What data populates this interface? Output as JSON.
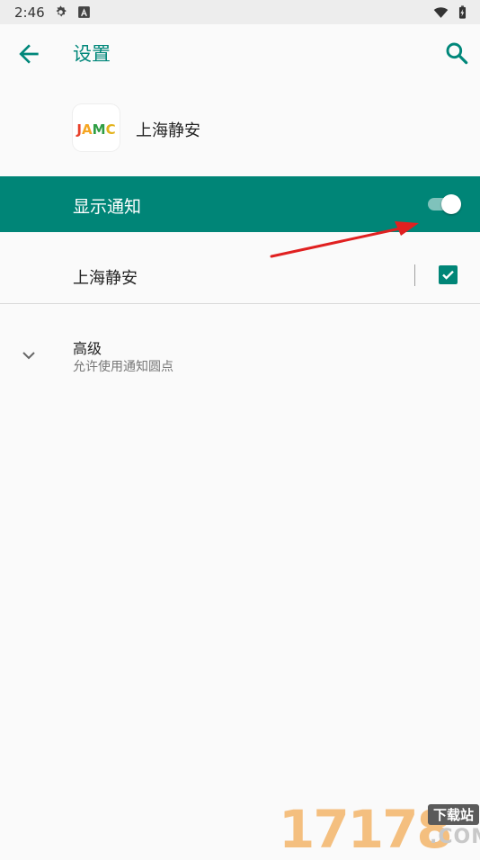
{
  "status_bar": {
    "time": "2:46",
    "icons": [
      "settings-gear-icon",
      "accessibility-a-icon",
      "wifi-icon",
      "battery-icon"
    ]
  },
  "app_bar": {
    "title": "设置",
    "back_icon": "arrow-back-icon",
    "search_icon": "search-icon"
  },
  "app_info": {
    "name": "上海静安",
    "logo_text": "JAMC"
  },
  "master_toggle": {
    "label": "显示通知",
    "on": true
  },
  "channel": {
    "label": "上海静安",
    "checked": true
  },
  "advanced": {
    "title": "高级",
    "subtitle": "允许使用通知圆点"
  },
  "watermark": {
    "digits": "17178",
    "top": "下载站",
    "com": ".COM"
  },
  "colors": {
    "accent": "#008577",
    "title": "#00877a",
    "annotation_arrow": "#e02020"
  }
}
